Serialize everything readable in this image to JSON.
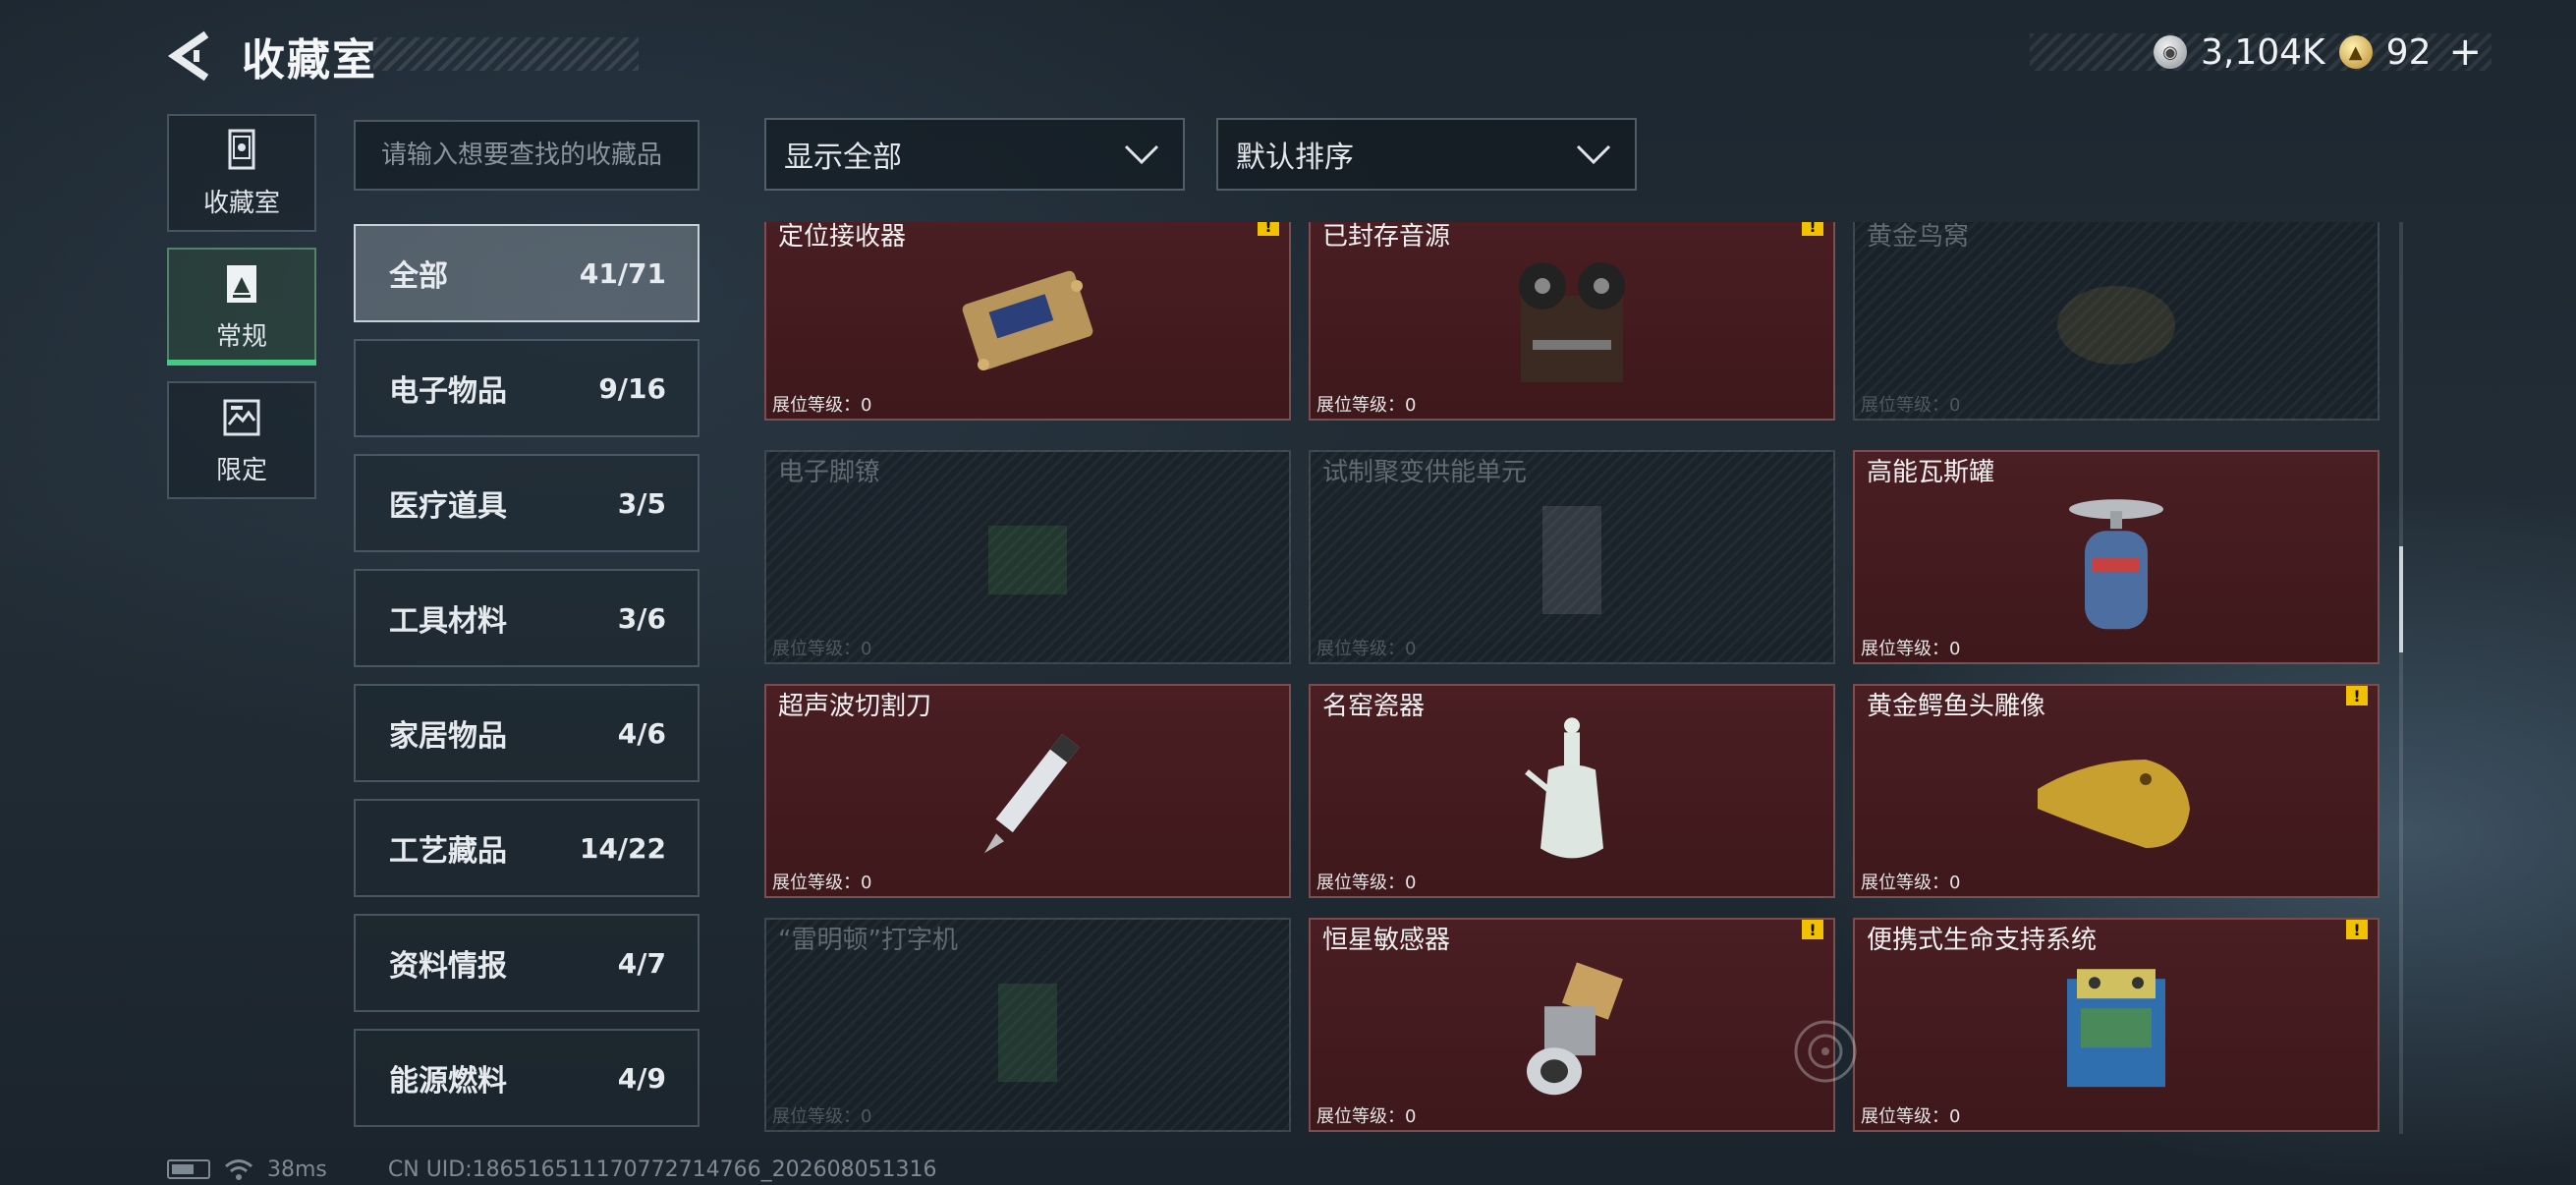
{
  "header": {
    "title": "收藏室"
  },
  "currency": [
    {
      "icon": "silver-coin-icon",
      "value": "3,104K"
    },
    {
      "icon": "gold-coin-icon",
      "value": "92"
    }
  ],
  "currency_plus": "+",
  "nav_tabs": [
    {
      "label": "收藏室",
      "icon": "display-case-icon",
      "active": false
    },
    {
      "label": "常规",
      "icon": "regular-collection-icon",
      "active": true
    },
    {
      "label": "限定",
      "icon": "limited-collection-icon",
      "active": false
    }
  ],
  "search": {
    "placeholder": "请输入想要查找的收藏品",
    "value": ""
  },
  "filters": {
    "show": "显示全部",
    "sort": "默认排序"
  },
  "categories": [
    {
      "name": "全部",
      "count": "41/71",
      "active": true
    },
    {
      "name": "电子物品",
      "count": "9/16"
    },
    {
      "name": "医疗道具",
      "count": "3/5"
    },
    {
      "name": "工具材料",
      "count": "3/6"
    },
    {
      "name": "家居物品",
      "count": "4/6"
    },
    {
      "name": "工艺藏品",
      "count": "14/22"
    },
    {
      "name": "资料情报",
      "count": "4/7"
    },
    {
      "name": "能源燃料",
      "count": "4/9"
    }
  ],
  "items": [
    {
      "name": "定位接收器",
      "level": "展位等级：0",
      "owned": true,
      "alert": true,
      "art": "receiver"
    },
    {
      "name": "已封存音源",
      "level": "展位等级：0",
      "owned": true,
      "alert": true,
      "art": "tape"
    },
    {
      "name": "黄金鸟窝",
      "level": "展位等级：0",
      "owned": false,
      "alert": false,
      "art": "nest"
    },
    {
      "name": "电子脚镣",
      "level": "展位等级：0",
      "owned": false,
      "alert": false,
      "art": "shackle"
    },
    {
      "name": "试制聚变供能单元",
      "level": "展位等级：0",
      "owned": false,
      "alert": false,
      "art": "fusion"
    },
    {
      "name": "高能瓦斯罐",
      "level": "展位等级：0",
      "owned": true,
      "alert": false,
      "art": "gas"
    },
    {
      "name": "超声波切割刀",
      "level": "展位等级：0",
      "owned": true,
      "alert": false,
      "art": "knife"
    },
    {
      "name": "名窑瓷器",
      "level": "展位等级：0",
      "owned": true,
      "alert": false,
      "art": "vase"
    },
    {
      "name": "黄金鳄鱼头雕像",
      "level": "展位等级：0",
      "owned": true,
      "alert": true,
      "art": "croc"
    },
    {
      "name": "“雷明顿”打字机",
      "level": "展位等级：0",
      "owned": false,
      "alert": false,
      "art": "typewriter"
    },
    {
      "name": "恒星敏感器",
      "level": "展位等级：0",
      "owned": true,
      "alert": true,
      "art": "sensor"
    },
    {
      "name": "便携式生命支持系统",
      "level": "展位等级：0",
      "owned": true,
      "alert": true,
      "art": "lifesupport"
    }
  ],
  "alert_mark": "!",
  "footer": {
    "ping": "38ms",
    "uid": "CN UID:186516511170772714766_202608051316"
  },
  "colors": {
    "accent": "#46c986",
    "owned_card": "#4a1e22",
    "alert": "#f2c200"
  }
}
